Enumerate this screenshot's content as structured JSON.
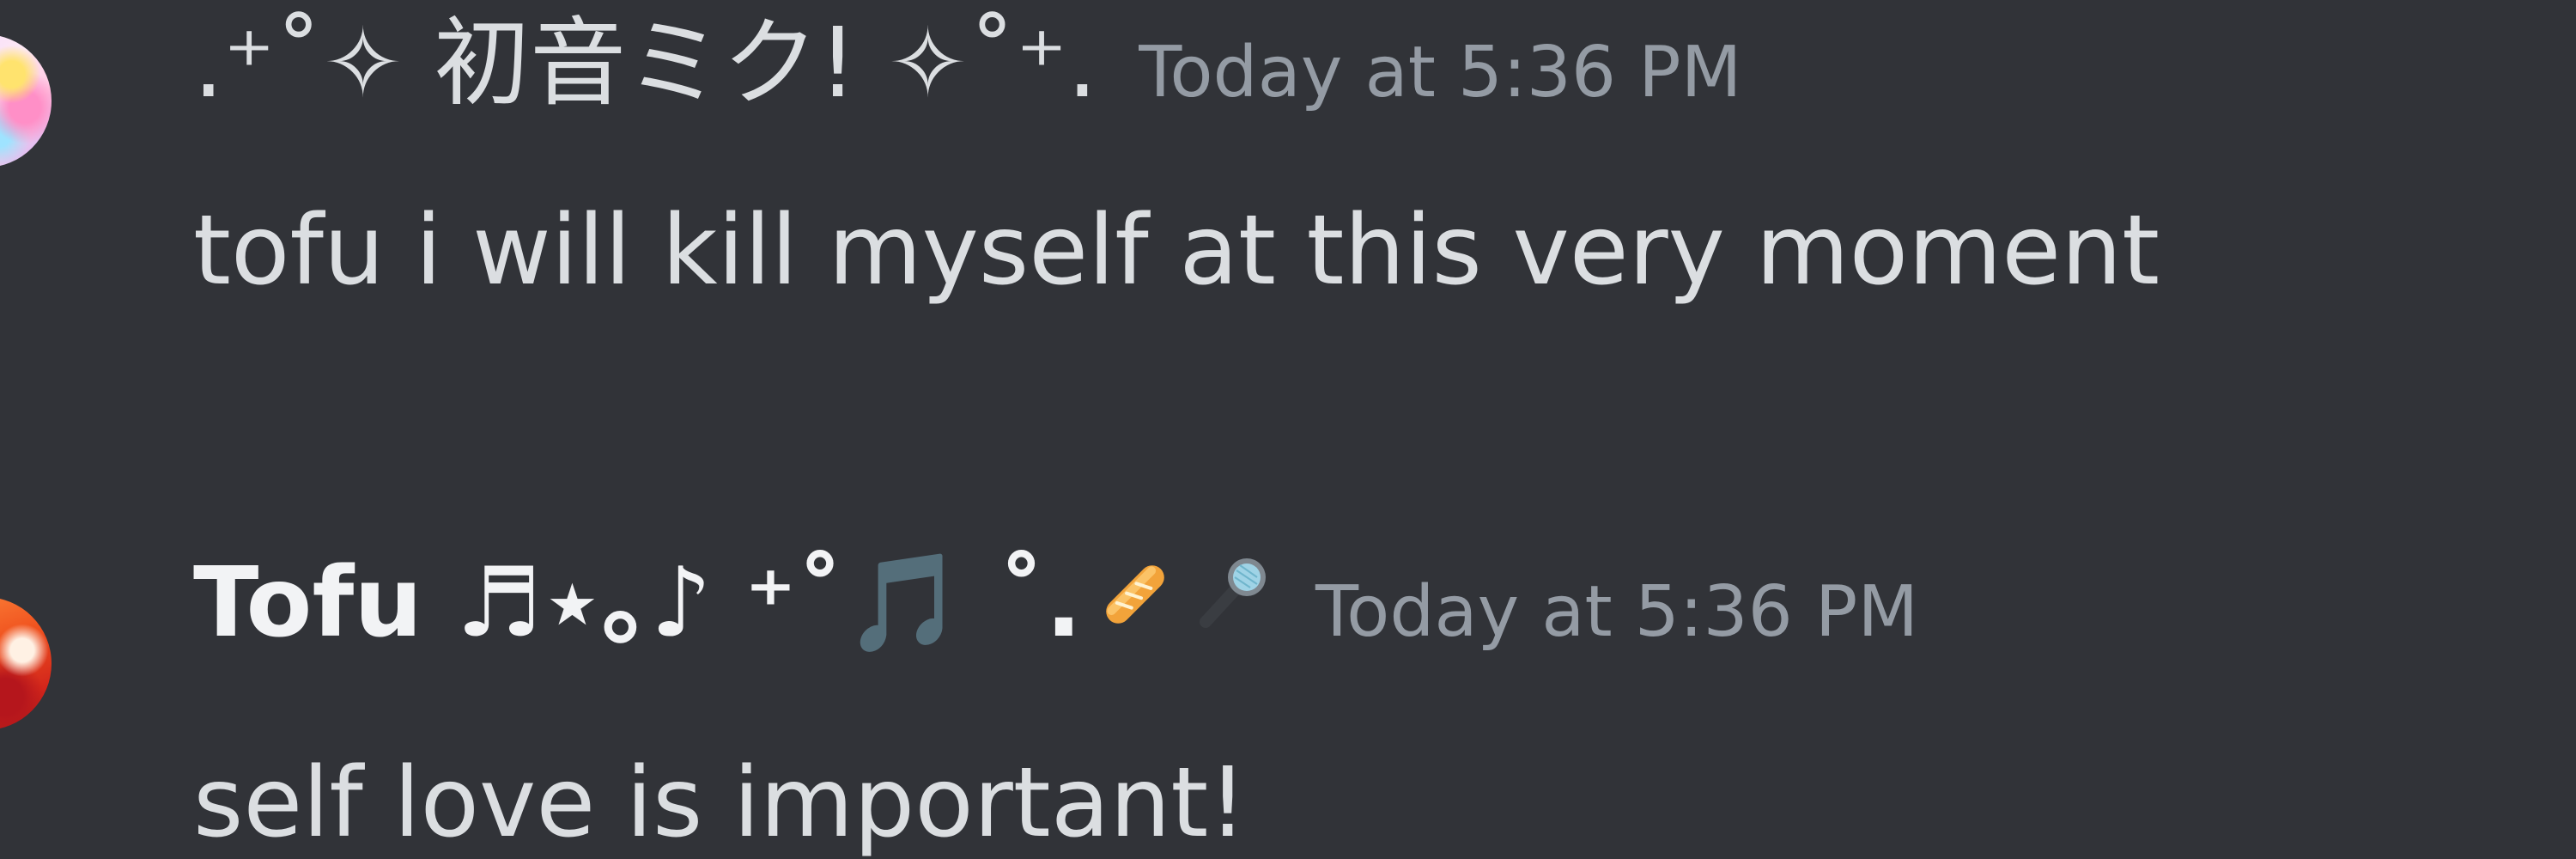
{
  "messages": [
    {
      "username": ".⁺˚✧ 初音ミク! ✧˚⁺.",
      "timestamp": "Today at 5:36 PM",
      "content": "tofu i will kill myself at this very moment",
      "name_color": "#dbdee1"
    },
    {
      "username": "Tofu ♬⋆｡♪ ⁺˚🎵 ˚.",
      "username_emojis": [
        "baguette-bread-icon",
        "microphone-icon"
      ],
      "timestamp": "Today at 5:36 PM",
      "content": "self love is important!",
      "name_color": "#f2f3f5"
    }
  ],
  "colors": {
    "background": "#313338",
    "text": "#dbdee1",
    "timestamp": "#949ba4"
  }
}
